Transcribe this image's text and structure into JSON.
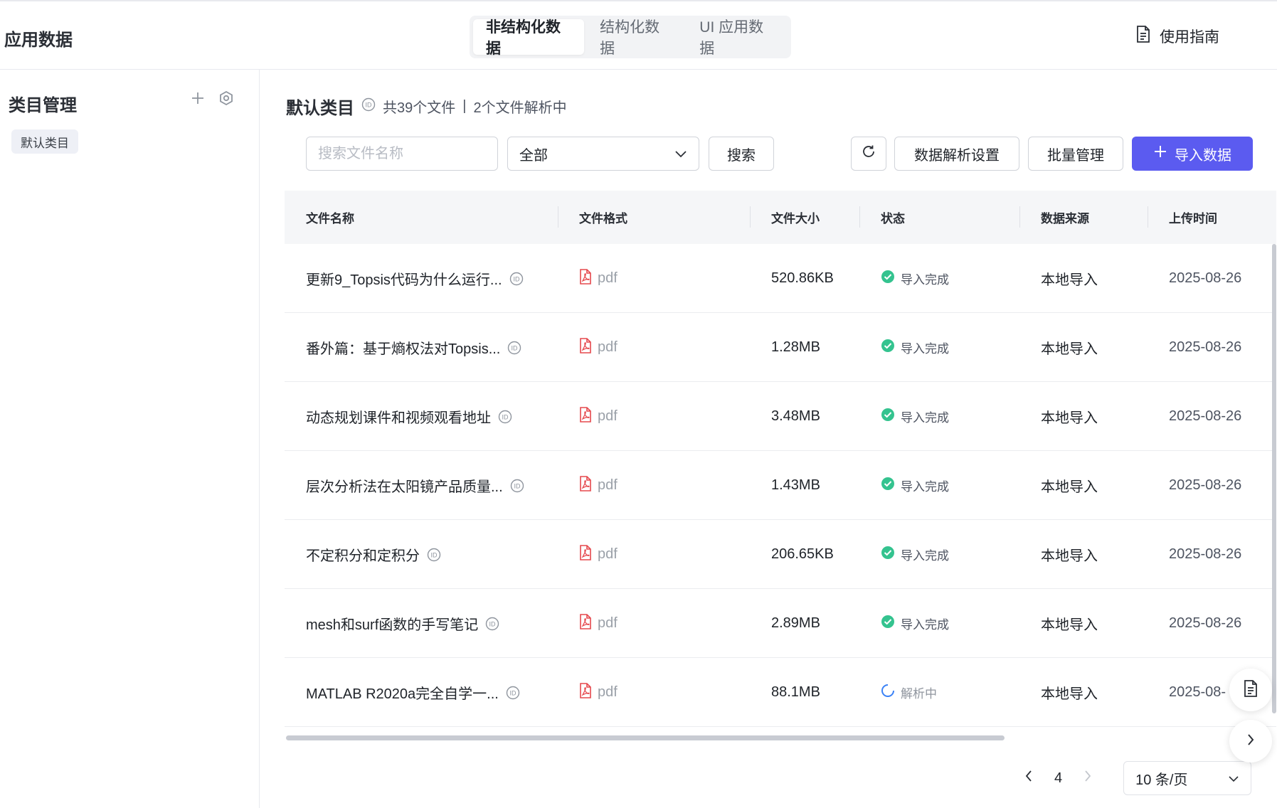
{
  "header": {
    "app_title": "应用数据",
    "tabs": [
      {
        "label": "非结构化数据",
        "active": true
      },
      {
        "label": "结构化数据",
        "active": false
      },
      {
        "label": "UI 应用数据",
        "active": false
      }
    ],
    "guide_label": "使用指南",
    "guide_icon": "document-icon"
  },
  "sidebar": {
    "title": "类目管理",
    "add_icon": "plus-icon",
    "settings_icon": "gear-icon",
    "categories": [
      {
        "label": "默认类目"
      }
    ]
  },
  "main": {
    "category_title": "默认类目",
    "file_count": "共39个文件",
    "separator": "|",
    "parsing_count": "2个文件解析中",
    "search_placeholder": "搜索文件名称",
    "filter_value": "全部",
    "search_button": "搜索",
    "refresh_icon": "refresh-icon",
    "parse_settings_button": "数据解析设置",
    "batch_manage_button": "批量管理",
    "import_button": "导入数据",
    "accent_color": "#5b5bf0"
  },
  "table": {
    "columns": [
      "文件名称",
      "文件格式",
      "文件大小",
      "状态",
      "数据来源",
      "上传时间"
    ],
    "rows": [
      {
        "name": "更新9_Topsis代码为什么运行...",
        "format": "pdf",
        "size": "520.86KB",
        "status": "导入完成",
        "status_type": "done",
        "source": "本地导入",
        "time": "2025-08-26"
      },
      {
        "name": "番外篇：基于熵权法对Topsis...",
        "format": "pdf",
        "size": "1.28MB",
        "status": "导入完成",
        "status_type": "done",
        "source": "本地导入",
        "time": "2025-08-26"
      },
      {
        "name": "动态规划课件和视频观看地址",
        "format": "pdf",
        "size": "3.48MB",
        "status": "导入完成",
        "status_type": "done",
        "source": "本地导入",
        "time": "2025-08-26"
      },
      {
        "name": "层次分析法在太阳镜产品质量...",
        "format": "pdf",
        "size": "1.43MB",
        "status": "导入完成",
        "status_type": "done",
        "source": "本地导入",
        "time": "2025-08-26"
      },
      {
        "name": "不定积分和定积分",
        "format": "pdf",
        "size": "206.65KB",
        "status": "导入完成",
        "status_type": "done",
        "source": "本地导入",
        "time": "2025-08-26"
      },
      {
        "name": "mesh和surf函数的手写笔记",
        "format": "pdf",
        "size": "2.89MB",
        "status": "导入完成",
        "status_type": "done",
        "source": "本地导入",
        "time": "2025-08-26"
      },
      {
        "name": "MATLAB R2020a完全自学一...",
        "format": "pdf",
        "size": "88.1MB",
        "status": "解析中",
        "status_type": "parsing",
        "source": "本地导入",
        "time": "2025-08-"
      }
    ],
    "status_colors": {
      "done": "#34c38f",
      "parsing": "#3b82f6"
    },
    "pdf_icon_color": "#e5484d"
  },
  "pagination": {
    "current_page": "4",
    "page_size": "10 条/页"
  }
}
